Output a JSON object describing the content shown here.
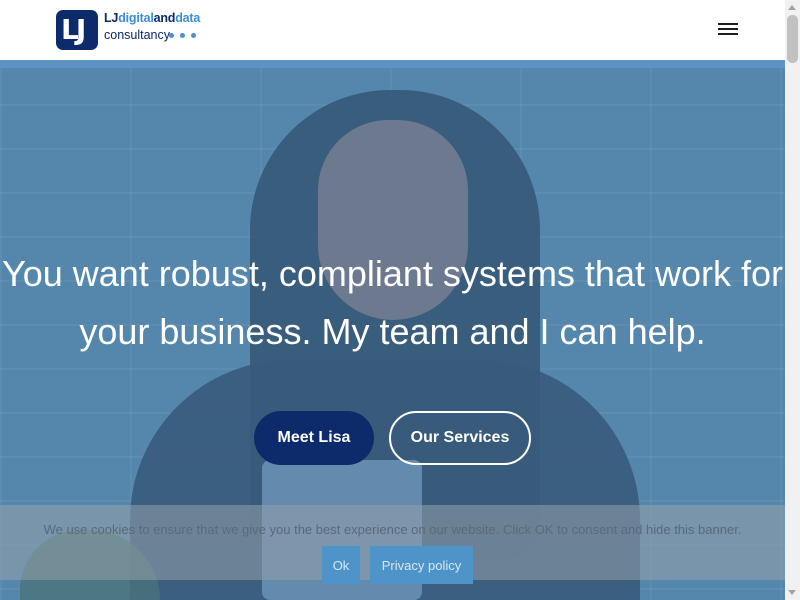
{
  "header": {
    "logo_mark": "LJ",
    "logo_line1_start": "LJ",
    "logo_line1_accent1": "digital",
    "logo_line1_mid": "and",
    "logo_line1_accent2": "data",
    "logo_line2": "consultancy",
    "menu_icon": "hamburger-menu-icon"
  },
  "hero": {
    "headline": "You want robust, compliant systems that work for your business. My team and I can help.",
    "buttons": {
      "meet_label": "Meet Lisa",
      "services_label": "Our Services"
    }
  },
  "cookie": {
    "text": "We use cookies to ensure that we give you the best experience on our website. Click OK to consent and hide this banner.",
    "ok_label": "Ok",
    "privacy_label": "Privacy policy"
  },
  "colors": {
    "brand_navy": "#0d2a6b",
    "brand_blue": "#3b8fd4",
    "cookie_button": "#4f94c8"
  }
}
